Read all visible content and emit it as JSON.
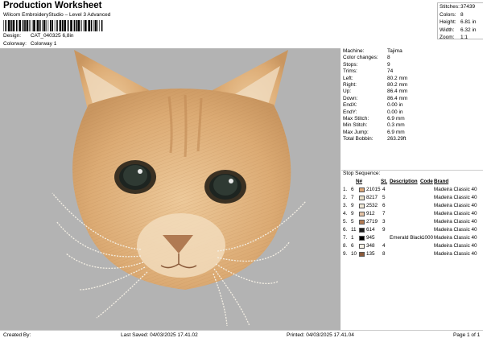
{
  "header": {
    "title": "Production Worksheet",
    "subtitle": "Wilcom EmbroideryStudio – Level 3 Advanced",
    "design_label": "Design:",
    "design_value": "CAT_040325 6,8in",
    "colorway_label": "Colorway:",
    "colorway_value": "Colorway 1"
  },
  "summary": [
    {
      "label": "Stitches:",
      "value": "37439"
    },
    {
      "label": "Colors:",
      "value": "8"
    },
    {
      "label": "Height:",
      "value": "6.81 in"
    },
    {
      "label": "Width:",
      "value": "6.32 in"
    },
    {
      "label": "Zoom:",
      "value": "1:1"
    }
  ],
  "info": [
    {
      "label": "Machine:",
      "value": "Tajima"
    },
    {
      "label": "Color changes:",
      "value": "8"
    },
    {
      "label": "Stops:",
      "value": "9"
    },
    {
      "label": "Trims:",
      "value": "74"
    },
    {
      "label": "Left:",
      "value": "80.2 mm"
    },
    {
      "label": "Right:",
      "value": "80.2 mm"
    },
    {
      "label": "Up:",
      "value": "86.4 mm"
    },
    {
      "label": "Down:",
      "value": "86.4 mm"
    },
    {
      "label": "EndX:",
      "value": "0.00 in"
    },
    {
      "label": "EndY:",
      "value": "0.00 in"
    },
    {
      "label": "Max Stitch:",
      "value": "6.9 mm"
    },
    {
      "label": "Min Stitch:",
      "value": "0.3 mm"
    },
    {
      "label": "Max Jump:",
      "value": "6.9 mm"
    },
    {
      "label": "Total Bobbin:",
      "value": "263.29ft"
    }
  ],
  "stop_sequence": {
    "title": "Stop Sequence:",
    "headers": {
      "num": "N#",
      "st": "St.",
      "description": "Description",
      "code": "Code",
      "brand": "Brand"
    },
    "rows": [
      {
        "seq": "1.",
        "num": "6",
        "color": "#d9a77a",
        "st": "21015",
        "n": "4",
        "description": "",
        "code": "",
        "brand": "Madeira Classic 40"
      },
      {
        "seq": "2.",
        "num": "7",
        "color": "#e8dfc8",
        "st": "8217",
        "n": "5",
        "description": "",
        "code": "",
        "brand": "Madeira Classic 40"
      },
      {
        "seq": "3.",
        "num": "9",
        "color": "#efe8d6",
        "st": "2532",
        "n": "6",
        "description": "",
        "code": "",
        "brand": "Madeira Classic 40"
      },
      {
        "seq": "4.",
        "num": "9",
        "color": "#e3c3a6",
        "st": "912",
        "n": "7",
        "description": "",
        "code": "",
        "brand": "Madeira Classic 40"
      },
      {
        "seq": "5.",
        "num": "5",
        "color": "#b07a52",
        "st": "2719",
        "n": "3",
        "description": "",
        "code": "",
        "brand": "Madeira Classic 40"
      },
      {
        "seq": "6.",
        "num": "11",
        "color": "#1e1e1e",
        "st": "614",
        "n": "9",
        "description": "",
        "code": "",
        "brand": "Madeira Classic 40"
      },
      {
        "seq": "7.",
        "num": "1",
        "color": "#000000",
        "st": "945",
        "n": "",
        "description": "Emerald Black",
        "code": "1000",
        "brand": "Madeira Classic 40"
      },
      {
        "seq": "8.",
        "num": "6",
        "color": "#f4efe4",
        "st": "348",
        "n": "4",
        "description": "",
        "code": "",
        "brand": "Madeira Classic 40"
      },
      {
        "seq": "9.",
        "num": "10",
        "color": "#8a5a3a",
        "st": "135",
        "n": "8",
        "description": "",
        "code": "",
        "brand": "Madeira Classic 40"
      }
    ]
  },
  "footer": {
    "created_by": "Created By:",
    "last_saved": "Last Saved: 04/03/2025 17.41.02",
    "printed": "Printed: 04/03/2025 17.41.04",
    "page": "Page 1 of 1"
  },
  "colors": {
    "canvas_bg": "#b3b3b3",
    "fur": "#d9a77a"
  }
}
